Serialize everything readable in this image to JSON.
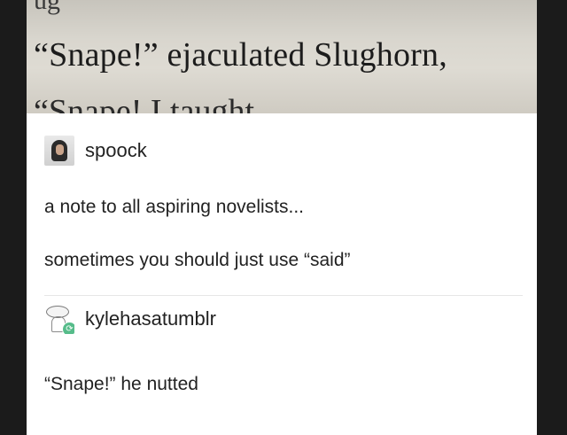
{
  "book_excerpt": {
    "line_top": "ug",
    "line_main": "“Snape!” ejaculated Slughorn,",
    "line_bottom": "“Snape! I taught"
  },
  "post1": {
    "username": "spoock",
    "avatar_icon": "snape-avatar-icon",
    "text1": "a note to all aspiring novelists...",
    "text2": "sometimes you should just use “said”"
  },
  "post2": {
    "username": "kylehasatumblr",
    "avatar_icon": "sketch-avatar-icon",
    "reblog_badge": "reblog-icon",
    "text1": "“Snape!” he nutted"
  },
  "colors": {
    "background": "#1b1b1b",
    "card": "#ffffff",
    "text": "#222222",
    "reblog_green": "#56bc8a"
  }
}
